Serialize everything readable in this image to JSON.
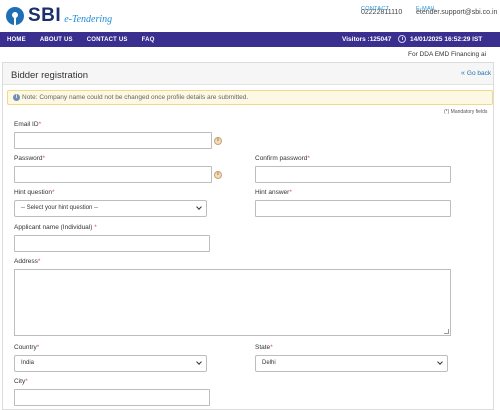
{
  "header": {
    "logo_text": "SBI",
    "logo_subtitle": "e-Tendering",
    "contact_label": "CONTACT",
    "contact_phone": "02222811110",
    "email_label": "E-MAIL",
    "email_value": "etender.support@sbi.co.in"
  },
  "nav": {
    "items": [
      "HOME",
      "ABOUT US",
      "CONTACT US",
      "FAQ"
    ],
    "visitors": "Visitors :125047",
    "datetime": "14/01/2025 16:52:29 IST"
  },
  "ticker": {
    "text": "For DDA EMD Financing ai"
  },
  "page": {
    "title": "Bidder registration",
    "go_back": "Go back",
    "note": "Note: Company name could not be changed once profile details are submitted.",
    "mandatory": "(*) Mandatory fields"
  },
  "form": {
    "email_label": "Email ID",
    "email_value": "",
    "password_label": "Password",
    "password_value": "",
    "confirm_password_label": "Confirm password",
    "confirm_password_value": "",
    "hint_question_label": "Hint question",
    "hint_question_value": "-- Select your hint question --",
    "hint_answer_label": "Hint answer",
    "hint_answer_value": "",
    "applicant_name_label": "Applicant name (Individual)",
    "applicant_name_value": "",
    "address_label": "Address",
    "address_value": "",
    "country_label": "Country",
    "country_value": "India",
    "state_label": "State",
    "state_value": "Delhi",
    "city_label": "City",
    "city_value": "",
    "required_mark": "*",
    "info_mark": "i"
  },
  "icons": {
    "note": "info-circle-icon",
    "field_help": "info-icon",
    "clock": "clock-icon",
    "back": "chevron-double-left-icon"
  },
  "colors": {
    "nav_bg": "#3a2f8f",
    "link": "#1f6fb5",
    "required": "#d9534f",
    "note_bg": "#fcf8e3"
  }
}
